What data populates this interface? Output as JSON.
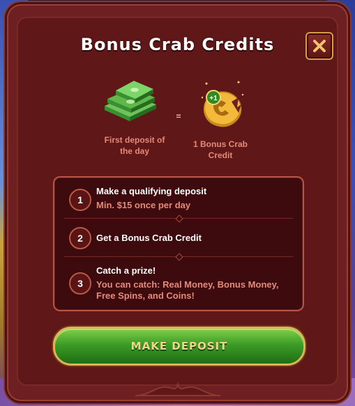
{
  "dialog": {
    "title": "Bonus Crab Credits",
    "close_icon": "close-x-icon"
  },
  "reward": {
    "left_caption": "First deposit of the day",
    "equals": "=",
    "right_caption": "1 Bonus Crab Credit",
    "badge": "+1",
    "left_icon": "cash-stack-icon",
    "right_icon": "crab-credit-coin-icon"
  },
  "steps": [
    {
      "number": "1",
      "title": "Make a qualifying deposit",
      "subtitle": "Min. $15 once per day"
    },
    {
      "number": "2",
      "title": "Get a Bonus Crab Credit",
      "subtitle": ""
    },
    {
      "number": "3",
      "title": "Catch a prize!",
      "subtitle": "You can catch: Real Money, Bonus Money, Free Spins, and Coins!"
    }
  ],
  "action": {
    "deposit_label": "MAKE DEPOSIT"
  },
  "colors": {
    "panel": "#6e1f21",
    "accent_text": "#e48a7b",
    "button_green": "#3e9c26",
    "gold_border": "#e0b25a"
  }
}
